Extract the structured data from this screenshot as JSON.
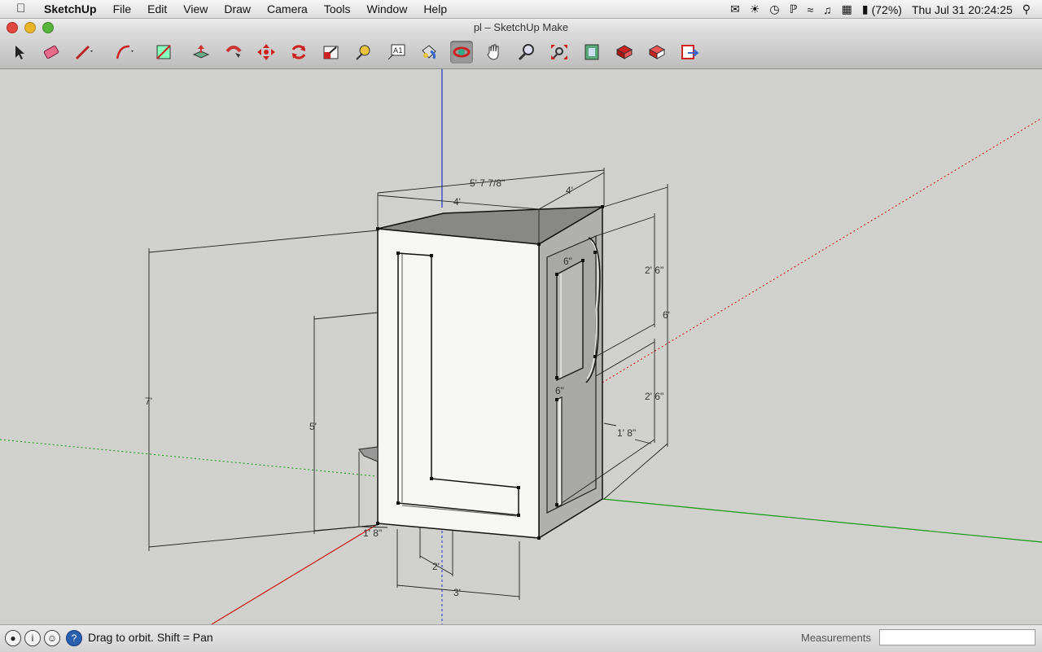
{
  "menubar": {
    "app_name": "SketchUp",
    "menus": [
      "File",
      "Edit",
      "View",
      "Draw",
      "Camera",
      "Tools",
      "Window",
      "Help"
    ],
    "battery": "(72%)",
    "clock": "Thu Jul 31  20:24:25"
  },
  "window": {
    "title": "pl – SketchUp Make"
  },
  "toolbar": {
    "tools": [
      "select-tool",
      "eraser-tool",
      "pencil-tool",
      "arc-tool",
      "rectangle-tool",
      "push-pull-tool",
      "follow-me-tool",
      "move-tool",
      "rotate-tool",
      "scale-tool",
      "tape-measure-tool",
      "text-tool",
      "paint-bucket-tool",
      "orbit-tool",
      "pan-tool",
      "zoom-tool",
      "zoom-extents-tool",
      "3d-warehouse-tool",
      "share-model-tool",
      "extension-warehouse-tool",
      "send-to-layout-tool"
    ],
    "active_tool": "orbit-tool"
  },
  "model": {
    "dimensions": {
      "top_diagonal": "5' 7 7/8\"",
      "top_front": "4'",
      "top_side": "4'",
      "height_total": "7'",
      "height_front": "5'",
      "right_height": "6'",
      "panel_upper": "2' 6\"",
      "panel_lower": "2' 6\"",
      "gap_upper": "6\"",
      "gap_lower": "6\"",
      "side_depth": "1' 8\"",
      "bottom_depth": "1' 8\"",
      "bottom_small": "2'",
      "bottom_width": "3'"
    },
    "axis_colors": {
      "blue": "#2233cc",
      "red": "#cc1111",
      "green": "#119911"
    }
  },
  "statusbar": {
    "hint": "Drag to orbit.  Shift = Pan",
    "measurements_label": "Measurements",
    "measurements_value": ""
  }
}
